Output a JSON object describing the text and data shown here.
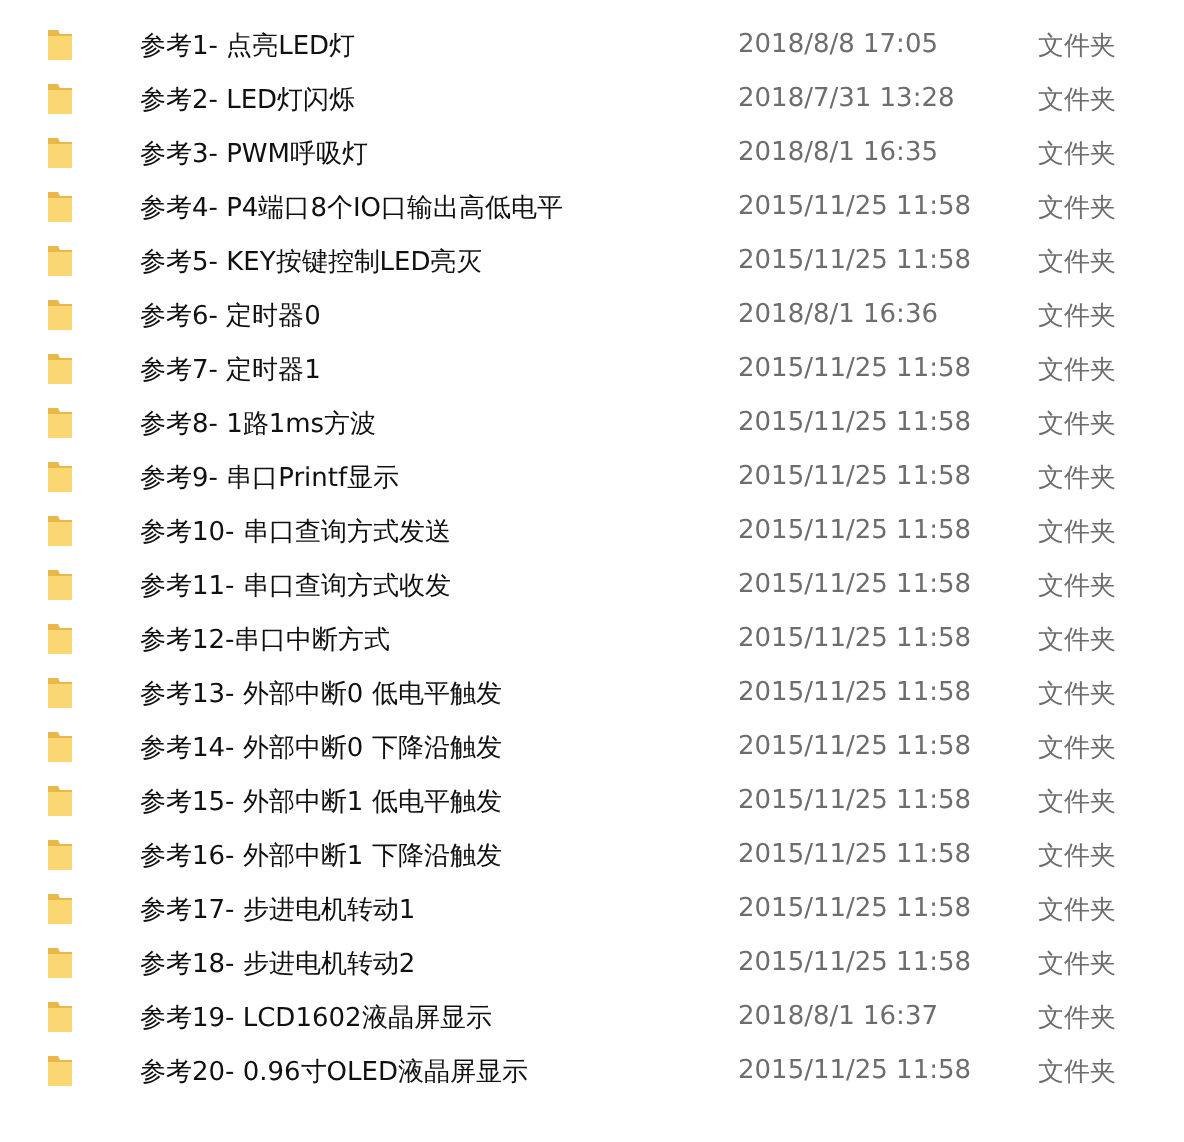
{
  "files": [
    {
      "name": "参考1- 点亮LED灯",
      "modified": "2018/8/8 17:05",
      "type": "文件夹"
    },
    {
      "name": "参考2- LED灯闪烁",
      "modified": "2018/7/31 13:28",
      "type": "文件夹"
    },
    {
      "name": "参考3- PWM呼吸灯",
      "modified": "2018/8/1 16:35",
      "type": "文件夹"
    },
    {
      "name": "参考4- P4端口8个IO口输出高低电平",
      "modified": "2015/11/25 11:58",
      "type": "文件夹"
    },
    {
      "name": "参考5- KEY按键控制LED亮灭",
      "modified": "2015/11/25 11:58",
      "type": "文件夹"
    },
    {
      "name": "参考6- 定时器0",
      "modified": "2018/8/1 16:36",
      "type": "文件夹"
    },
    {
      "name": "参考7- 定时器1",
      "modified": "2015/11/25 11:58",
      "type": "文件夹"
    },
    {
      "name": "参考8- 1路1ms方波",
      "modified": "2015/11/25 11:58",
      "type": "文件夹"
    },
    {
      "name": "参考9- 串口Printf显示",
      "modified": "2015/11/25 11:58",
      "type": "文件夹"
    },
    {
      "name": "参考10- 串口查询方式发送",
      "modified": "2015/11/25 11:58",
      "type": "文件夹"
    },
    {
      "name": "参考11- 串口查询方式收发",
      "modified": "2015/11/25 11:58",
      "type": "文件夹"
    },
    {
      "name": "参考12-串口中断方式",
      "modified": "2015/11/25 11:58",
      "type": "文件夹"
    },
    {
      "name": "参考13- 外部中断0 低电平触发",
      "modified": "2015/11/25 11:58",
      "type": "文件夹"
    },
    {
      "name": "参考14- 外部中断0 下降沿触发",
      "modified": "2015/11/25 11:58",
      "type": "文件夹"
    },
    {
      "name": "参考15- 外部中断1 低电平触发",
      "modified": "2015/11/25 11:58",
      "type": "文件夹"
    },
    {
      "name": "参考16- 外部中断1 下降沿触发",
      "modified": "2015/11/25 11:58",
      "type": "文件夹"
    },
    {
      "name": "参考17- 步进电机转动1",
      "modified": "2015/11/25 11:58",
      "type": "文件夹"
    },
    {
      "name": "参考18- 步进电机转动2",
      "modified": "2015/11/25 11:58",
      "type": "文件夹"
    },
    {
      "name": "参考19- LCD1602液晶屏显示",
      "modified": "2018/8/1 16:37",
      "type": "文件夹"
    },
    {
      "name": "参考20- 0.96寸OLED液晶屏显示",
      "modified": "2015/11/25 11:58",
      "type": "文件夹"
    }
  ]
}
